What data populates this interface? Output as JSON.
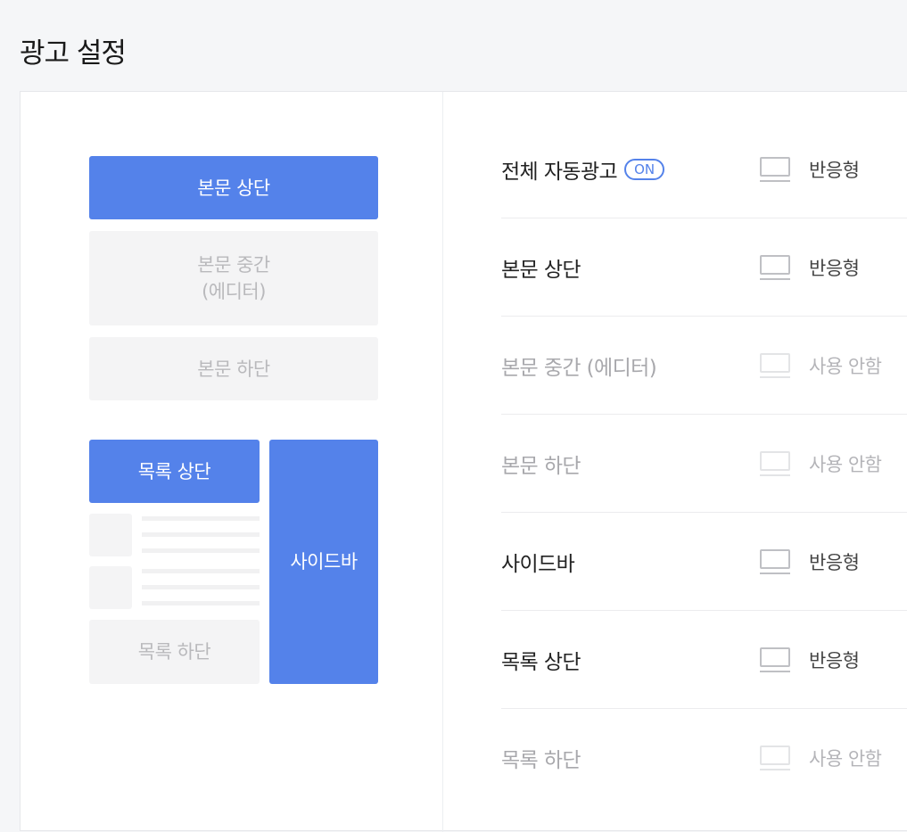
{
  "page": {
    "title": "광고 설정"
  },
  "preview": {
    "body_top": "본문 상단",
    "body_middle_line1": "본문 중간",
    "body_middle_line2": "(에디터)",
    "body_bottom": "본문 하단",
    "list_top": "목록 상단",
    "sidebar": "사이드바",
    "list_bottom": "목록 하단"
  },
  "settings": {
    "rows": [
      {
        "label": "전체 자동광고",
        "badge": "ON",
        "status": "반응형",
        "enabled": true
      },
      {
        "label": "본문 상단",
        "status": "반응형",
        "enabled": true
      },
      {
        "label": "본문 중간 (에디터)",
        "status": "사용 안함",
        "enabled": false
      },
      {
        "label": "본문 하단",
        "status": "사용 안함",
        "enabled": false
      },
      {
        "label": "사이드바",
        "status": "반응형",
        "enabled": true
      },
      {
        "label": "목록 상단",
        "status": "반응형",
        "enabled": true
      },
      {
        "label": "목록 하단",
        "status": "사용 안함",
        "enabled": false
      }
    ]
  },
  "colors": {
    "accent": "#5482ea",
    "inactive_block": "#f4f4f5",
    "background": "#f5f6f8"
  },
  "icons": {
    "device": "monitor-icon"
  }
}
